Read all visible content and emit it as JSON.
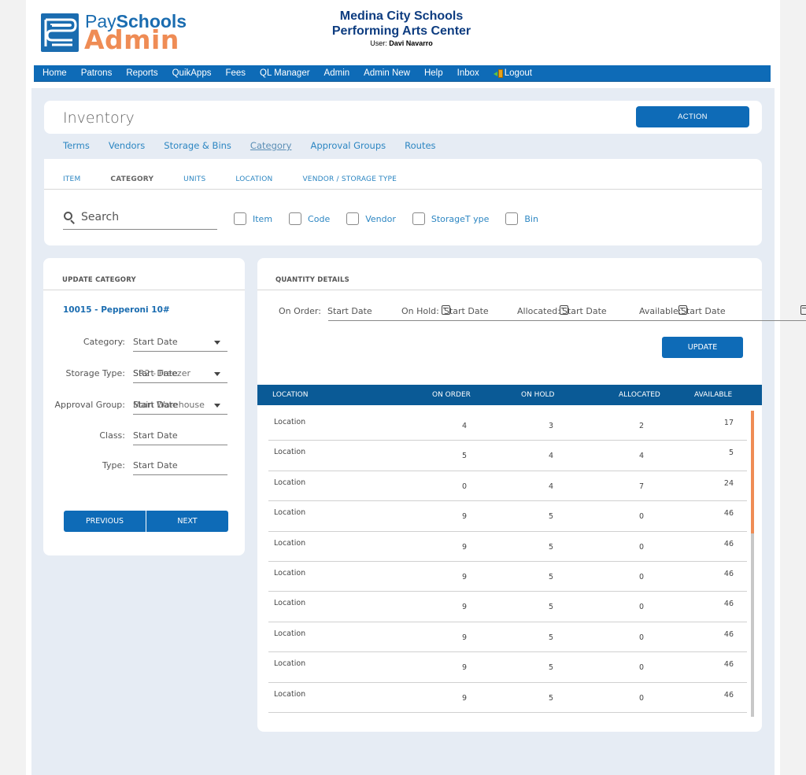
{
  "header": {
    "logo": {
      "pay": "Pay",
      "schools": "Schools",
      "admin": "Admin"
    },
    "district": "Medina City Schools",
    "site": "Performing Arts Center",
    "user_label": "User:",
    "user_name": "Davi Navarro"
  },
  "topnav": {
    "items": [
      "Home",
      "Patrons",
      "Reports",
      "QuikApps",
      "Fees",
      "QL Manager",
      "Admin",
      "Admin New",
      "Help",
      "Inbox"
    ],
    "logout": "Logout"
  },
  "page": {
    "title": "Inventory",
    "action_label": "ACTION"
  },
  "subnav": {
    "items": [
      "Terms",
      "Vendors",
      "Storage & Bins",
      "Category",
      "Approval Groups",
      "Routes"
    ],
    "active": "Category"
  },
  "tabs": {
    "items": [
      "ITEM",
      "CATEGORY",
      "UNITS",
      "LOCATION",
      "VENDOR / STORAGE TYPE"
    ],
    "active": "CATEGORY"
  },
  "search": {
    "placeholder": "Search",
    "filters": [
      "Item",
      "Code",
      "Vendor",
      "StorageT ype",
      "Bin"
    ]
  },
  "update_category": {
    "heading": "UPDATE CATEGORY",
    "item": "10015 - Pepperoni 10#",
    "fields": [
      {
        "label": "Category:",
        "value": "Start Date",
        "overlay": ""
      },
      {
        "label": "Storage Type:",
        "value": "Start Date",
        "overlay": "SR2 - Freezer"
      },
      {
        "label": "Approval Group:",
        "value": "Start Date",
        "overlay": "Main Warehouse"
      },
      {
        "label": "Class:",
        "value": "Start Date"
      },
      {
        "label": "Type:",
        "value": "Start Date"
      }
    ],
    "previous_label": "PREVIOUS",
    "next_label": "NEXT"
  },
  "quantity_details": {
    "heading": "QUANTITY DETAILS",
    "fields": [
      {
        "label": "On Order:",
        "value": "Start Date"
      },
      {
        "label": "On Hold:",
        "value": "Start Date"
      },
      {
        "label": "Allocated:",
        "value": "Start Date"
      },
      {
        "label": "Available:",
        "value": "Start Date"
      }
    ],
    "update_label": "UPDATE",
    "table": {
      "columns": [
        "LOCATION",
        "ON ORDER",
        "ON HOLD",
        "ALLOCATED",
        "AVAILABLE"
      ],
      "rows": [
        [
          "Location",
          "4",
          "3",
          "2",
          "17"
        ],
        [
          "Location",
          "5",
          "4",
          "4",
          "5"
        ],
        [
          "Location",
          "0",
          "4",
          "7",
          "24"
        ],
        [
          "Location",
          "9",
          "5",
          "0",
          "46"
        ],
        [
          "Location",
          "9",
          "5",
          "0",
          "46"
        ],
        [
          "Location",
          "9",
          "5",
          "0",
          "46"
        ],
        [
          "Location",
          "9",
          "5",
          "0",
          "46"
        ],
        [
          "Location",
          "9",
          "5",
          "0",
          "46"
        ],
        [
          "Location",
          "9",
          "5",
          "0",
          "46"
        ],
        [
          "Location",
          "9",
          "5",
          "0",
          "46"
        ]
      ]
    },
    "scroll_position_fraction": 0.0,
    "scroll_visible_fraction": 0.4
  },
  "colors": {
    "primary": "#0e6bb7",
    "table_header": "#0a5a96",
    "accent_orange": "#ef8c55",
    "link": "#2c86c2",
    "content_bg": "#e6ecf4"
  }
}
